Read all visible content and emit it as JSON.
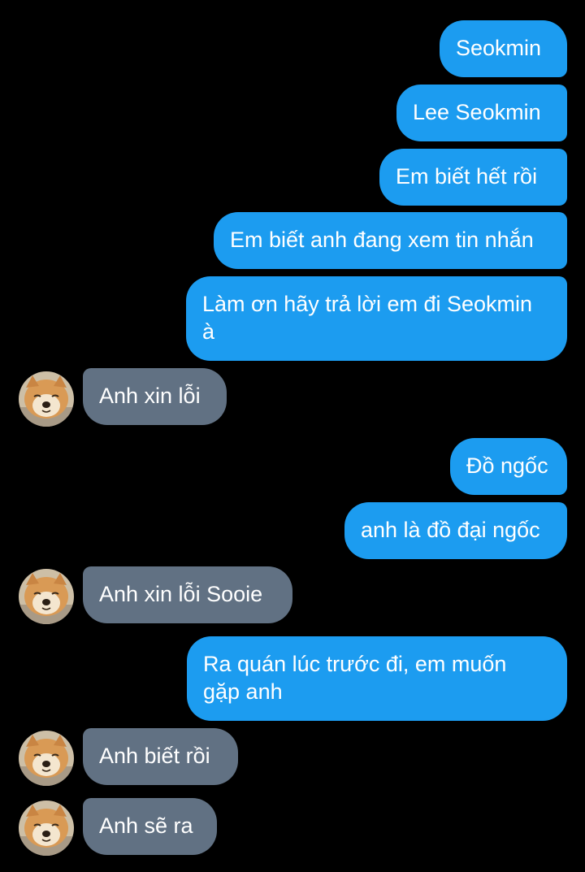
{
  "conversation": {
    "messages": [
      {
        "sender": "me",
        "text": "Seokmin"
      },
      {
        "sender": "me",
        "text": "Lee Seokmin"
      },
      {
        "sender": "me",
        "text": "Em biết hết rồi"
      },
      {
        "sender": "me",
        "text": "Em biết anh đang xem tin nhắn"
      },
      {
        "sender": "me",
        "text": "Làm ơn hãy trả lời em đi Seokmin\nà"
      },
      {
        "sender": "other",
        "text": "Anh xin lỗi"
      },
      {
        "sender": "me",
        "text": "Đồ ngốc"
      },
      {
        "sender": "me",
        "text": "anh là đồ đại ngốc"
      },
      {
        "sender": "other",
        "text": "Anh xin lỗi Sooie"
      },
      {
        "sender": "me",
        "text": "Ra quán lúc trước đi, em muốn\ngặp anh"
      },
      {
        "sender": "other",
        "text": "Anh biết rồi"
      },
      {
        "sender": "other",
        "text": "Anh sẽ ra"
      }
    ]
  },
  "colors": {
    "background": "#000000",
    "sent_bubble": "#1c9cf0",
    "received_bubble": "#617183",
    "text": "#ffffff"
  },
  "icons": {
    "avatar": "shiba-dog-avatar-icon"
  }
}
